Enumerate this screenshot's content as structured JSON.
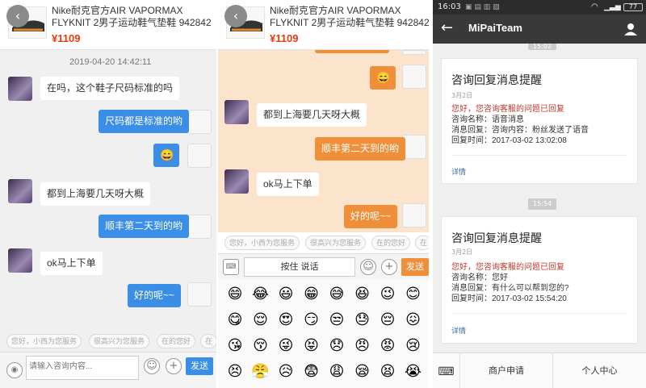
{
  "product": {
    "title": "Nike耐克官方AIR VAPORMAX FLYKNIT 2男子运动鞋气垫鞋 942842",
    "price": "¥1109"
  },
  "panel1": {
    "timestamp": "2019-04-20 14:42:11",
    "messages": [
      {
        "side": "left",
        "text": "在吗，这个鞋子尺码标准的吗"
      },
      {
        "side": "right",
        "text": "尺码都是标准的哟"
      },
      {
        "side": "right",
        "text": "😄"
      },
      {
        "side": "left",
        "text": "都到上海要几天呀大概"
      },
      {
        "side": "right",
        "text": "顺丰第二天到的哟"
      },
      {
        "side": "left",
        "text": "ok马上下单"
      },
      {
        "side": "right",
        "text": "好的呢~~"
      }
    ],
    "quick_replies": [
      "您好，小西为您服务",
      "很高兴为您服务",
      "在的您好",
      "在"
    ],
    "input_placeholder": "请输入咨询内容...",
    "send_label": "发送"
  },
  "panel2": {
    "messages": [
      {
        "side": "right",
        "text": "😄"
      },
      {
        "side": "left",
        "text": "都到上海要几天呀大概"
      },
      {
        "side": "right",
        "text": "顺丰第二天到的哟"
      },
      {
        "side": "left",
        "text": "ok马上下单"
      },
      {
        "side": "right",
        "text": "好的呢~~"
      }
    ],
    "quick_replies": [
      "您好，小西为您服务",
      "很高兴为您服务",
      "在的您好",
      "在"
    ],
    "hold_to_talk": "按住 说话",
    "send_label": "发送",
    "emojis": [
      "😄",
      "😂",
      "😃",
      "😁",
      "😅",
      "😆",
      "😉",
      "😊",
      "😋",
      "😌",
      "😍",
      "😏",
      "😒",
      "😓",
      "😔",
      "😖",
      "😘",
      "😚",
      "😜",
      "😝",
      "😞",
      "😠",
      "😡",
      "😢",
      "😣",
      "😤",
      "😥",
      "😨",
      "😩",
      "😪",
      "😫",
      "😭"
    ]
  },
  "panel3": {
    "status": {
      "time": "16:03",
      "battery": "77"
    },
    "nav_title": "MiPaiTeam",
    "time_pill_1": "15:02",
    "time_pill_2": "15:54",
    "cards": [
      {
        "title": "咨询回复消息提醒",
        "date": "3月2日",
        "highlight": "您好，您咨询客服的问题已回复",
        "lines": [
          "咨询名称：语音消息",
          "消息回复：咨询内容：粉丝发送了语音",
          "回复时间：2017-03-02 13:02:08"
        ],
        "more": "详情"
      },
      {
        "title": "咨询回复消息提醒",
        "date": "3月2日",
        "highlight": "您好，您咨询客服的问题已回复",
        "lines": [
          "咨询名称：您好",
          "消息回复：有什么可以帮到您的?",
          "回复时间：2017-03-02 15:54:20"
        ],
        "more": "详情"
      }
    ],
    "bottom_items": [
      "商户申请",
      "个人中心"
    ]
  },
  "colors": {
    "blue_bubble": "#3a8ee6",
    "orange_bubble": "#f08f3a",
    "price": "#e8380d",
    "highlight": "#c0392b"
  }
}
